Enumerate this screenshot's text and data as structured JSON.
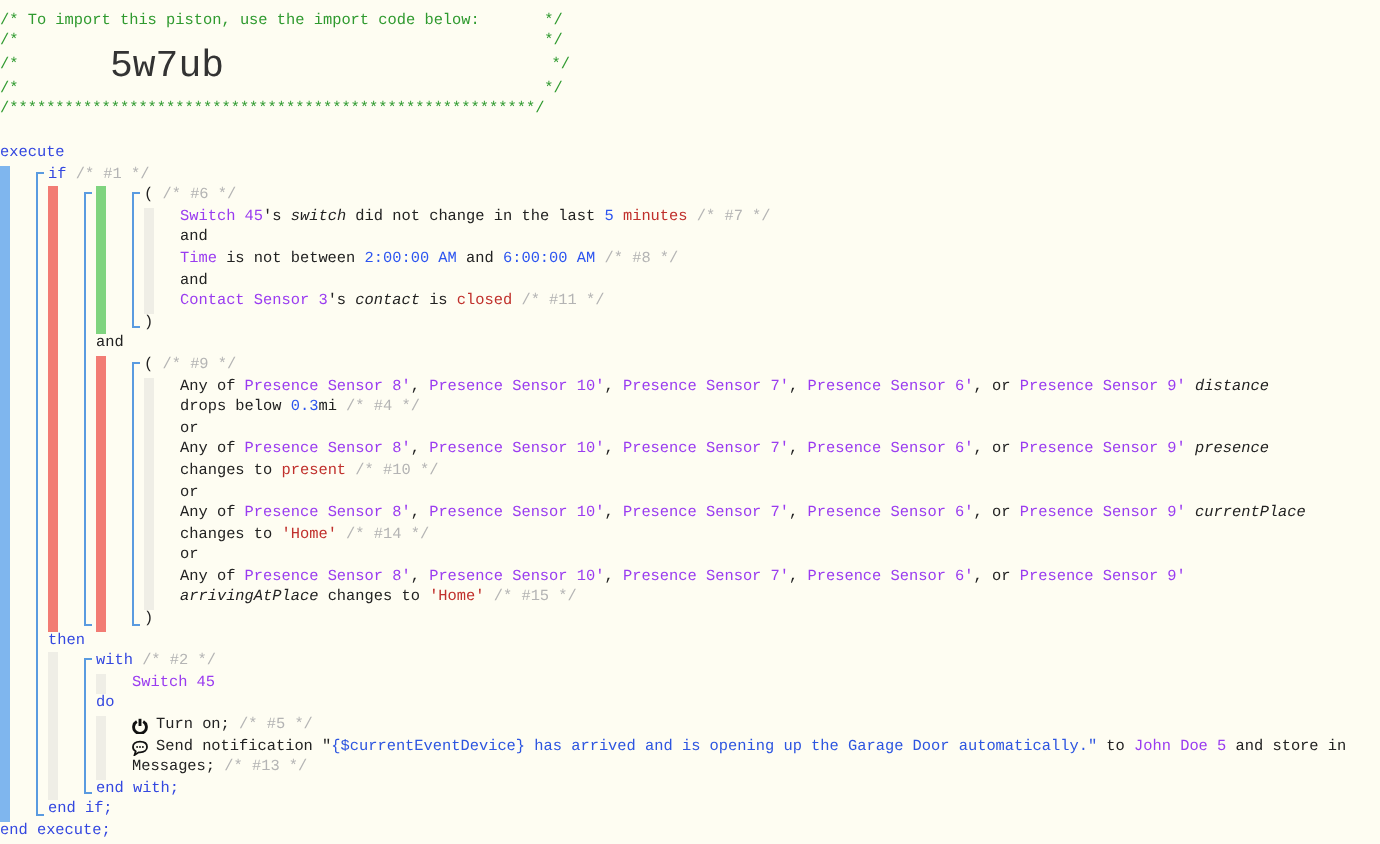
{
  "header": {
    "lines": [
      {
        "kind": "text",
        "text": "/* To import this piston, use the import code below:       */"
      },
      {
        "kind": "text",
        "text": "/*                                                         */"
      },
      {
        "kind": "code",
        "left": "/*",
        "code": "5w7ub",
        "right": "*/"
      },
      {
        "kind": "text",
        "text": "/*                                                         */"
      },
      {
        "kind": "text",
        "text": "/*********************************************************/"
      }
    ]
  },
  "code": [
    {
      "kind": "line",
      "tokens": [
        {
          "kind": "keyword",
          "text": "execute"
        }
      ]
    },
    {
      "kind": "executing-band",
      "children": [
        {
          "kind": "group",
          "bracket": true,
          "children": [
            {
              "kind": "line",
              "tokens": [
                {
                  "kind": "keyword",
                  "text": "if"
                },
                {
                  "kind": "comment",
                  "text": " /* #1 */"
                }
              ]
            },
            {
              "kind": "false-band",
              "children": [
                {
                  "kind": "group",
                  "bracket": true,
                  "children": [
                    {
                      "kind": "true-band",
                      "children": [
                        {
                          "kind": "group",
                          "bracket": true,
                          "children": [
                            {
                              "kind": "line",
                              "tokens": [
                                {
                                  "kind": "plain",
                                  "text": "( "
                                },
                                {
                                  "kind": "comment",
                                  "text": "/* #6 */"
                                }
                              ]
                            },
                            {
                              "kind": "idle-band",
                              "children": [
                                {
                                  "kind": "line",
                                  "tokens": [
                                    {
                                      "kind": "device",
                                      "text": "Switch 45"
                                    },
                                    {
                                      "kind": "plain",
                                      "text": "'s "
                                    },
                                    {
                                      "kind": "attribute",
                                      "text": "switch"
                                    },
                                    {
                                      "kind": "plain",
                                      "text": " did not change in the last "
                                    },
                                    {
                                      "kind": "number",
                                      "text": "5"
                                    },
                                    {
                                      "kind": "value",
                                      "text": " minutes"
                                    },
                                    {
                                      "kind": "comment",
                                      "text": " /* #7 */"
                                    }
                                  ]
                                },
                                {
                                  "kind": "line",
                                  "tokens": [
                                    {
                                      "kind": "plain",
                                      "text": "and"
                                    }
                                  ]
                                },
                                {
                                  "kind": "line",
                                  "tokens": [
                                    {
                                      "kind": "device",
                                      "text": "Time"
                                    },
                                    {
                                      "kind": "plain",
                                      "text": " is not between "
                                    },
                                    {
                                      "kind": "number",
                                      "text": "2:00:00 AM"
                                    },
                                    {
                                      "kind": "plain",
                                      "text": " and "
                                    },
                                    {
                                      "kind": "number",
                                      "text": "6:00:00 AM"
                                    },
                                    {
                                      "kind": "comment",
                                      "text": " /* #8 */"
                                    }
                                  ]
                                },
                                {
                                  "kind": "line",
                                  "tokens": [
                                    {
                                      "kind": "plain",
                                      "text": "and"
                                    }
                                  ]
                                },
                                {
                                  "kind": "line",
                                  "tokens": [
                                    {
                                      "kind": "device",
                                      "text": "Contact Sensor 3"
                                    },
                                    {
                                      "kind": "plain",
                                      "text": "'s "
                                    },
                                    {
                                      "kind": "attribute",
                                      "text": "contact"
                                    },
                                    {
                                      "kind": "plain",
                                      "text": " is "
                                    },
                                    {
                                      "kind": "value",
                                      "text": "closed"
                                    },
                                    {
                                      "kind": "comment",
                                      "text": " /* #11 */"
                                    }
                                  ]
                                }
                              ]
                            },
                            {
                              "kind": "line",
                              "tokens": [
                                {
                                  "kind": "plain",
                                  "text": ")"
                                }
                              ]
                            }
                          ]
                        }
                      ]
                    },
                    {
                      "kind": "line",
                      "tokens": [
                        {
                          "kind": "plain",
                          "text": "and"
                        }
                      ]
                    },
                    {
                      "kind": "false-band",
                      "children": [
                        {
                          "kind": "group",
                          "bracket": true,
                          "children": [
                            {
                              "kind": "line",
                              "tokens": [
                                {
                                  "kind": "plain",
                                  "text": "( "
                                },
                                {
                                  "kind": "comment",
                                  "text": "/* #9 */"
                                }
                              ]
                            },
                            {
                              "kind": "idle-band",
                              "children": [
                                {
                                  "kind": "line",
                                  "tokens": [
                                    {
                                      "kind": "plain",
                                      "text": "Any of "
                                    },
                                    {
                                      "kind": "device",
                                      "text": "Presence Sensor 8'"
                                    },
                                    {
                                      "kind": "plain",
                                      "text": ", "
                                    },
                                    {
                                      "kind": "device",
                                      "text": "Presence Sensor 10'"
                                    },
                                    {
                                      "kind": "plain",
                                      "text": ", "
                                    },
                                    {
                                      "kind": "device",
                                      "text": "Presence Sensor 7'"
                                    },
                                    {
                                      "kind": "plain",
                                      "text": ", "
                                    },
                                    {
                                      "kind": "device",
                                      "text": "Presence Sensor 6'"
                                    },
                                    {
                                      "kind": "plain",
                                      "text": ", or "
                                    },
                                    {
                                      "kind": "device",
                                      "text": "Presence Sensor 9'"
                                    },
                                    {
                                      "kind": "attribute",
                                      "text": " distance"
                                    }
                                  ]
                                },
                                {
                                  "kind": "line",
                                  "tokens": [
                                    {
                                      "kind": "plain",
                                      "text": "drops below "
                                    },
                                    {
                                      "kind": "number",
                                      "text": "0.3"
                                    },
                                    {
                                      "kind": "plain",
                                      "text": "mi"
                                    },
                                    {
                                      "kind": "comment",
                                      "text": " /* #4 */"
                                    }
                                  ]
                                },
                                {
                                  "kind": "line",
                                  "tokens": [
                                    {
                                      "kind": "plain",
                                      "text": "or"
                                    }
                                  ]
                                },
                                {
                                  "kind": "line",
                                  "tokens": [
                                    {
                                      "kind": "plain",
                                      "text": "Any of "
                                    },
                                    {
                                      "kind": "device",
                                      "text": "Presence Sensor 8'"
                                    },
                                    {
                                      "kind": "plain",
                                      "text": ", "
                                    },
                                    {
                                      "kind": "device",
                                      "text": "Presence Sensor 10'"
                                    },
                                    {
                                      "kind": "plain",
                                      "text": ", "
                                    },
                                    {
                                      "kind": "device",
                                      "text": "Presence Sensor 7'"
                                    },
                                    {
                                      "kind": "plain",
                                      "text": ", "
                                    },
                                    {
                                      "kind": "device",
                                      "text": "Presence Sensor 6'"
                                    },
                                    {
                                      "kind": "plain",
                                      "text": ", or "
                                    },
                                    {
                                      "kind": "device",
                                      "text": "Presence Sensor 9'"
                                    },
                                    {
                                      "kind": "attribute",
                                      "text": " presence"
                                    }
                                  ]
                                },
                                {
                                  "kind": "line",
                                  "tokens": [
                                    {
                                      "kind": "plain",
                                      "text": "changes to "
                                    },
                                    {
                                      "kind": "value",
                                      "text": "present"
                                    },
                                    {
                                      "kind": "comment",
                                      "text": " /* #10 */"
                                    }
                                  ]
                                },
                                {
                                  "kind": "line",
                                  "tokens": [
                                    {
                                      "kind": "plain",
                                      "text": "or"
                                    }
                                  ]
                                },
                                {
                                  "kind": "line",
                                  "tokens": [
                                    {
                                      "kind": "plain",
                                      "text": "Any of "
                                    },
                                    {
                                      "kind": "device",
                                      "text": "Presence Sensor 8'"
                                    },
                                    {
                                      "kind": "plain",
                                      "text": ", "
                                    },
                                    {
                                      "kind": "device",
                                      "text": "Presence Sensor 10'"
                                    },
                                    {
                                      "kind": "plain",
                                      "text": ", "
                                    },
                                    {
                                      "kind": "device",
                                      "text": "Presence Sensor 7'"
                                    },
                                    {
                                      "kind": "plain",
                                      "text": ", "
                                    },
                                    {
                                      "kind": "device",
                                      "text": "Presence Sensor 6'"
                                    },
                                    {
                                      "kind": "plain",
                                      "text": ", or "
                                    },
                                    {
                                      "kind": "device",
                                      "text": "Presence Sensor 9'"
                                    },
                                    {
                                      "kind": "attribute",
                                      "text": " currentPlace"
                                    }
                                  ]
                                },
                                {
                                  "kind": "line",
                                  "tokens": [
                                    {
                                      "kind": "plain",
                                      "text": "changes to "
                                    },
                                    {
                                      "kind": "value",
                                      "text": "'Home'"
                                    },
                                    {
                                      "kind": "comment",
                                      "text": " /* #14 */"
                                    }
                                  ]
                                },
                                {
                                  "kind": "line",
                                  "tokens": [
                                    {
                                      "kind": "plain",
                                      "text": "or"
                                    }
                                  ]
                                },
                                {
                                  "kind": "line",
                                  "tokens": [
                                    {
                                      "kind": "plain",
                                      "text": "Any of "
                                    },
                                    {
                                      "kind": "device",
                                      "text": "Presence Sensor 8'"
                                    },
                                    {
                                      "kind": "plain",
                                      "text": ", "
                                    },
                                    {
                                      "kind": "device",
                                      "text": "Presence Sensor 10'"
                                    },
                                    {
                                      "kind": "plain",
                                      "text": ", "
                                    },
                                    {
                                      "kind": "device",
                                      "text": "Presence Sensor 7'"
                                    },
                                    {
                                      "kind": "plain",
                                      "text": ", "
                                    },
                                    {
                                      "kind": "device",
                                      "text": "Presence Sensor 6'"
                                    },
                                    {
                                      "kind": "plain",
                                      "text": ", or "
                                    },
                                    {
                                      "kind": "device",
                                      "text": "Presence Sensor 9'"
                                    }
                                  ]
                                },
                                {
                                  "kind": "line",
                                  "tokens": [
                                    {
                                      "kind": "attribute",
                                      "text": "arrivingAtPlace"
                                    },
                                    {
                                      "kind": "plain",
                                      "text": " changes to "
                                    },
                                    {
                                      "kind": "value",
                                      "text": "'Home'"
                                    },
                                    {
                                      "kind": "comment",
                                      "text": " /* #15 */"
                                    }
                                  ]
                                }
                              ]
                            },
                            {
                              "kind": "line",
                              "tokens": [
                                {
                                  "kind": "plain",
                                  "text": ")"
                                }
                              ]
                            }
                          ]
                        }
                      ]
                    }
                  ]
                }
              ]
            },
            {
              "kind": "line",
              "tokens": [
                {
                  "kind": "keyword",
                  "text": "then"
                }
              ]
            },
            {
              "kind": "idle-band",
              "children": [
                {
                  "kind": "group",
                  "bracket": true,
                  "children": [
                    {
                      "kind": "line",
                      "tokens": [
                        {
                          "kind": "keyword",
                          "text": "with"
                        },
                        {
                          "kind": "comment",
                          "text": " /* #2 */"
                        }
                      ]
                    },
                    {
                      "kind": "idle-band",
                      "children": [
                        {
                          "kind": "line",
                          "tokens": [
                            {
                              "kind": "device",
                              "text": "Switch 45"
                            }
                          ]
                        }
                      ]
                    },
                    {
                      "kind": "line",
                      "tokens": [
                        {
                          "kind": "keyword",
                          "text": "do"
                        }
                      ]
                    },
                    {
                      "kind": "idle-band",
                      "children": [
                        {
                          "kind": "power-task",
                          "tokens": [
                            {
                              "kind": "plain",
                              "text": "Turn on;"
                            },
                            {
                              "kind": "comment",
                              "text": " /* #5 */"
                            }
                          ]
                        },
                        {
                          "kind": "message-task",
                          "tokens": [
                            {
                              "kind": "plain",
                              "text": "Send notification \""
                            },
                            {
                              "kind": "expression",
                              "text": "{$currentEventDevice} has arrived and is opening up the Garage Door automatically.\""
                            },
                            {
                              "kind": "plain",
                              "text": " to "
                            },
                            {
                              "kind": "device",
                              "text": "John Doe 5"
                            },
                            {
                              "kind": "plain",
                              "text": " and store in"
                            }
                          ]
                        },
                        {
                          "kind": "line",
                          "tokens": [
                            {
                              "kind": "plain",
                              "text": "Messages;"
                            },
                            {
                              "kind": "comment",
                              "text": " /* #13 */"
                            }
                          ]
                        }
                      ]
                    },
                    {
                      "kind": "line",
                      "tokens": [
                        {
                          "kind": "keyword",
                          "text": "end with;"
                        }
                      ]
                    }
                  ]
                }
              ]
            },
            {
              "kind": "line",
              "tokens": [
                {
                  "kind": "keyword",
                  "text": "end if;"
                }
              ]
            }
          ]
        }
      ]
    },
    {
      "kind": "line",
      "tokens": [
        {
          "kind": "keyword",
          "text": "end execute;"
        }
      ]
    }
  ]
}
